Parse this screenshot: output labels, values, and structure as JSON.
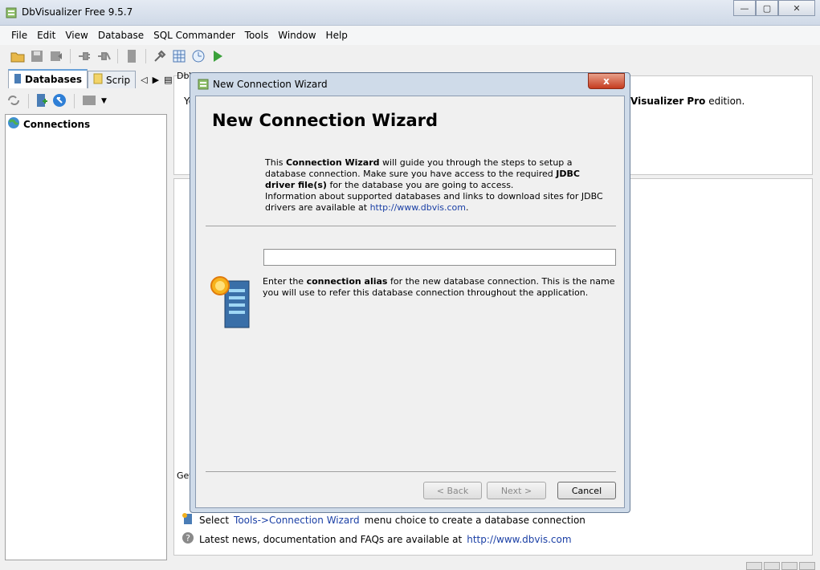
{
  "window": {
    "title": "DbVisualizer Free 9.5.7"
  },
  "menu": [
    "File",
    "Edit",
    "View",
    "Database",
    "SQL Commander",
    "Tools",
    "Window",
    "Help"
  ],
  "left": {
    "tabs": [
      {
        "label": "Databases"
      },
      {
        "label": "Scrip"
      }
    ],
    "tree": {
      "root": "Connections"
    }
  },
  "background": {
    "panel_title_fragment": "DbV",
    "top_text_left": "Yo",
    "top_text_right_bold": "Visualizer Pro",
    "top_text_right": "edition.",
    "section_label": "Get",
    "tip1_prefix": "Select",
    "tip1_link": "Tools->Connection Wizard",
    "tip1_suffix": "menu choice to create a database connection",
    "tip2_prefix": "Latest news, documentation and FAQs are available at",
    "tip2_link": "http://www.dbvis.com"
  },
  "dialog": {
    "title": "New Connection Wizard",
    "heading": "New Connection Wizard",
    "intro": {
      "p1": "This",
      "p1_bold": "Connection Wizard",
      "p2": "will guide you through the steps to setup a database connection. Make sure you have access to the required",
      "p2_bold": "JDBC driver file(s)",
      "p3": "for the database you are going to access.",
      "p4": "Information about supported databases and links to download sites for JDBC drivers are available at",
      "link": "http://www.dbvis.com",
      "p4_end": "."
    },
    "alias_value": "",
    "alias_desc_1": "Enter the",
    "alias_desc_bold": "connection alias",
    "alias_desc_2": "for the new database connection. This is the name you will use to refer this database connection throughout the application.",
    "buttons": {
      "back": "< Back",
      "next": "Next >",
      "cancel": "Cancel"
    },
    "close_label": "x"
  },
  "icons": [
    "app-icon",
    "open-folder-icon",
    "save-icon",
    "export-icon",
    "connect-icon",
    "disconnect-icon",
    "driver-icon",
    "tools-icon",
    "grid-icon",
    "monitor-icon",
    "run-icon",
    "refresh-icon",
    "add-connection-icon",
    "info-icon",
    "database-wizard-icon",
    "help-icon"
  ]
}
